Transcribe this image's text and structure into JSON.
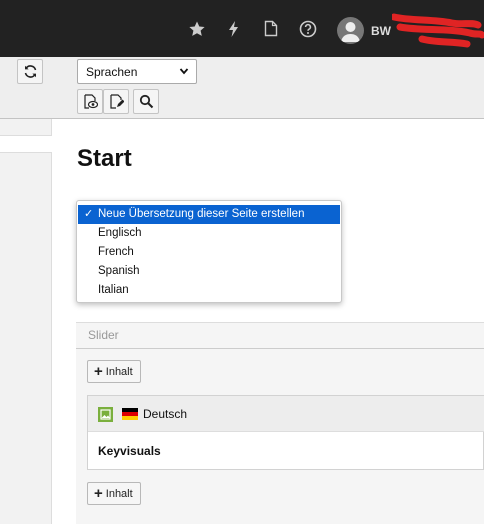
{
  "topbar": {
    "icons": [
      "star-icon",
      "bolt-icon",
      "document-icon",
      "help-icon"
    ],
    "user_name": "BW"
  },
  "docheader": {
    "language_select": {
      "value": "Sprachen"
    },
    "buttons": [
      "view-page-icon",
      "edit-page-icon",
      "search-icon"
    ]
  },
  "page": {
    "title": "Start"
  },
  "language_dropdown": {
    "options": [
      "Neue Übersetzung dieser Seite erstellen",
      "Englisch",
      "French",
      "Spanish",
      "Italian"
    ],
    "selected_index": 0,
    "check": "✓"
  },
  "column": {
    "title": "Slider",
    "add_content_label": "Inhalt",
    "element": {
      "language": "Deutsch",
      "title": "Keyvisuals"
    }
  },
  "colors": {
    "selection": "#0a63d1",
    "topbar": "#222222",
    "ce_icon": "#7aaf3d"
  }
}
